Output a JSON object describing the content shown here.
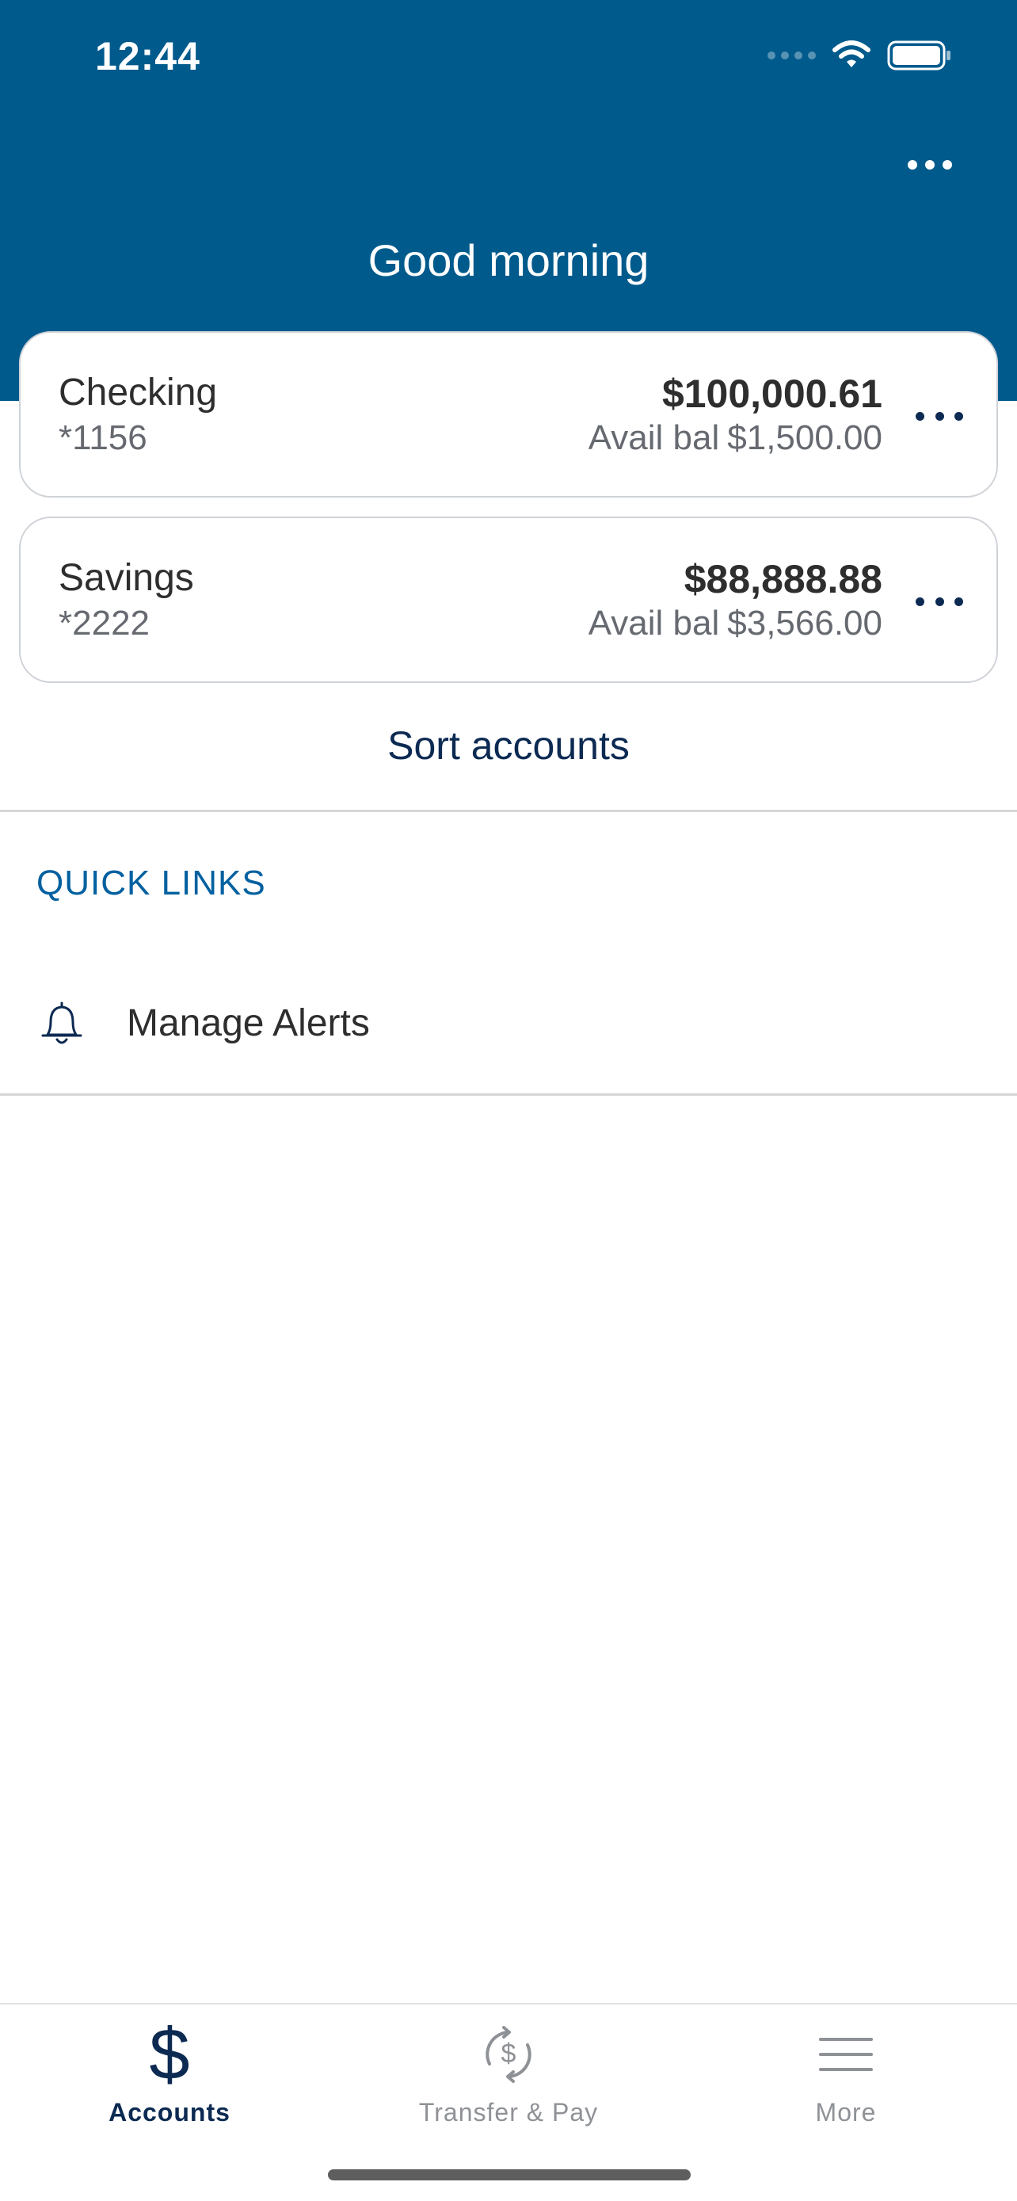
{
  "status_bar": {
    "time": "12:44"
  },
  "header": {
    "greeting": "Good morning"
  },
  "accounts": [
    {
      "name": "Checking",
      "mask": "*1156",
      "balance": "$100,000.61",
      "avail_prefix": "Avail bal",
      "avail_amount": "$1,500.00"
    },
    {
      "name": "Savings",
      "mask": "*2222",
      "balance": "$88,888.88",
      "avail_prefix": "Avail bal",
      "avail_amount": "$3,566.00"
    }
  ],
  "sort_accounts_label": "Sort accounts",
  "quick_links": {
    "title": "QUICK LINKS",
    "items": [
      {
        "label": "Manage Alerts",
        "icon": "bell-icon"
      }
    ]
  },
  "tabs": [
    {
      "label": "Accounts",
      "icon": "dollar-icon",
      "active": true
    },
    {
      "label": "Transfer & Pay",
      "icon": "transfer-pay-icon",
      "active": false
    },
    {
      "label": "More",
      "icon": "hamburger-menu-icon",
      "active": false
    }
  ],
  "colors": {
    "header_blue": "#005a8c",
    "navy": "#0c2a52",
    "link_blue": "#0060a0",
    "inactive_gray": "#8e9196"
  }
}
